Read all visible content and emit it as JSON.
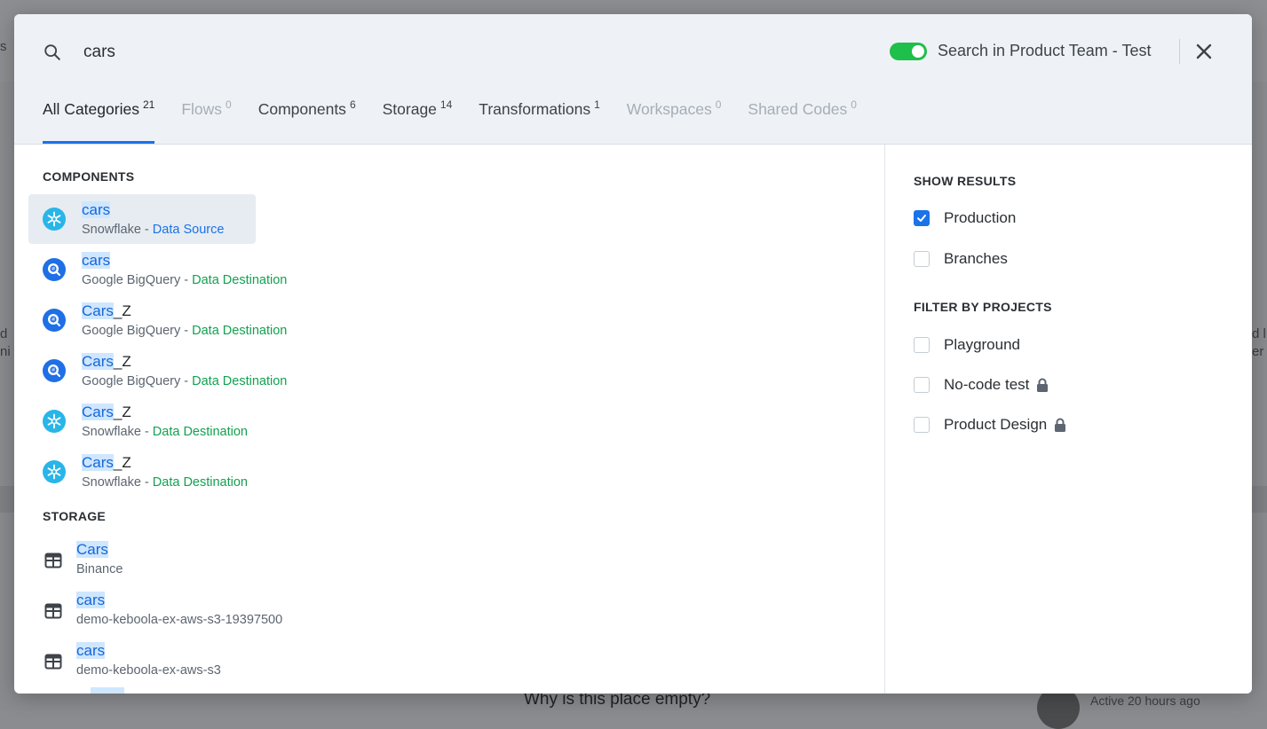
{
  "background": {
    "empty_text": "Why is this place empty?",
    "active_text": "Active 20 hours ago",
    "left_fragments": [
      "s",
      "d",
      "ni"
    ],
    "right_fragments": [
      "d l",
      "er"
    ]
  },
  "search": {
    "query": "cars",
    "toggle_on": true,
    "toggle_label": "Search in Product Team - Test",
    "accent": "#1a73e8",
    "toggle_color": "#1fbf4c"
  },
  "tabs": [
    {
      "label": "All Categories",
      "count": "21",
      "state": "active"
    },
    {
      "label": "Flows",
      "count": "0",
      "state": "disabled"
    },
    {
      "label": "Components",
      "count": "6",
      "state": "normal"
    },
    {
      "label": "Storage",
      "count": "14",
      "state": "normal"
    },
    {
      "label": "Transformations",
      "count": "1",
      "state": "normal"
    },
    {
      "label": "Workspaces",
      "count": "0",
      "state": "disabled"
    },
    {
      "label": "Shared Codes",
      "count": "0",
      "state": "disabled"
    }
  ],
  "components": {
    "title": "COMPONENTS",
    "items": [
      {
        "match": "cars",
        "rest": "",
        "source": "Snowflake",
        "sep": " - ",
        "type": "Data Source",
        "icon": "snowflake-icon"
      },
      {
        "match": "cars",
        "rest": "",
        "source": "Google BigQuery",
        "sep": " - ",
        "type": "Data Destination",
        "icon": "bigquery-icon"
      },
      {
        "match": "Cars",
        "rest": "_Z",
        "source": "Google BigQuery",
        "sep": " - ",
        "type": "Data Destination",
        "icon": "bigquery-icon"
      },
      {
        "match": "Cars",
        "rest": "_Z",
        "source": "Google BigQuery",
        "sep": " - ",
        "type": "Data Destination",
        "icon": "bigquery-icon"
      },
      {
        "match": "Cars",
        "rest": "_Z",
        "source": "Snowflake",
        "sep": " - ",
        "type": "Data Destination",
        "icon": "snowflake-icon"
      },
      {
        "match": "Cars",
        "rest": "_Z",
        "source": "Snowflake",
        "sep": " - ",
        "type": "Data Destination",
        "icon": "snowflake-icon"
      }
    ]
  },
  "storage": {
    "title": "STORAGE",
    "items": [
      {
        "name": "Cars",
        "bucket": "Binance"
      },
      {
        "name": "cars",
        "bucket": "demo-keboola-ex-aws-s3-19397500"
      },
      {
        "name": "cars",
        "bucket": "demo-keboola-ex-aws-s3"
      }
    ]
  },
  "filters": {
    "show_title": "SHOW RESULTS",
    "show": [
      {
        "label": "Production",
        "checked": true
      },
      {
        "label": "Branches",
        "checked": false
      }
    ],
    "projects_title": "FILTER BY PROJECTS",
    "projects": [
      {
        "label": "Playground",
        "locked": false
      },
      {
        "label": "No-code test",
        "locked": true
      },
      {
        "label": "Product Design",
        "locked": true
      }
    ]
  }
}
